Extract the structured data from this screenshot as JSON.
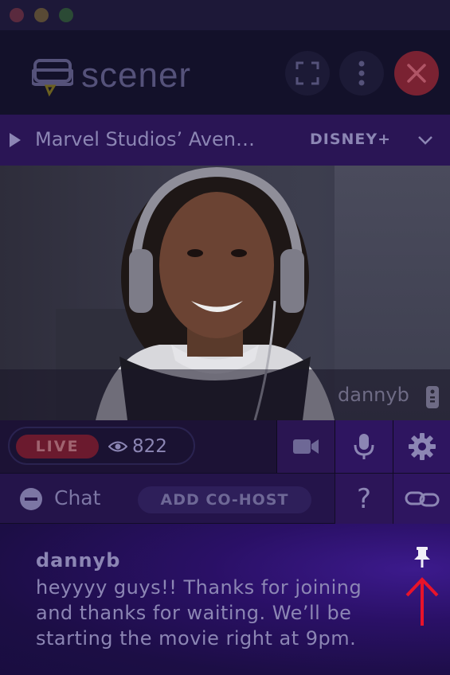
{
  "app": {
    "name": "scener"
  },
  "window": {
    "buttons": [
      "close",
      "minimize",
      "maximize"
    ]
  },
  "header": {
    "logo_text": "scener",
    "icons": {
      "fullscreen": "fullscreen-icon",
      "more": "more-vertical-icon",
      "close": "close-icon"
    }
  },
  "media_bar": {
    "title": "Marvel Studios’ Aven…",
    "service": "DISNEY+"
  },
  "video": {
    "participant_name": "dannyb"
  },
  "controls": {
    "live_label": "LIVE",
    "viewer_count": "822",
    "icons": [
      "camera-icon",
      "microphone-icon",
      "gear-icon"
    ]
  },
  "chat_bar": {
    "chat_label": "Chat",
    "add_cohost_label": "ADD CO-HOST",
    "help_label": "?"
  },
  "message": {
    "author": "dannyb",
    "text": "heyyyy guys!! Thanks for joining and thanks for waiting. We’ll be starting the movie right at 9pm."
  },
  "colors": {
    "accent_purple": "#2e1560",
    "live_red": "#6b1a2e",
    "close_red": "#7a2232",
    "annotation_red": "#e8132a"
  }
}
